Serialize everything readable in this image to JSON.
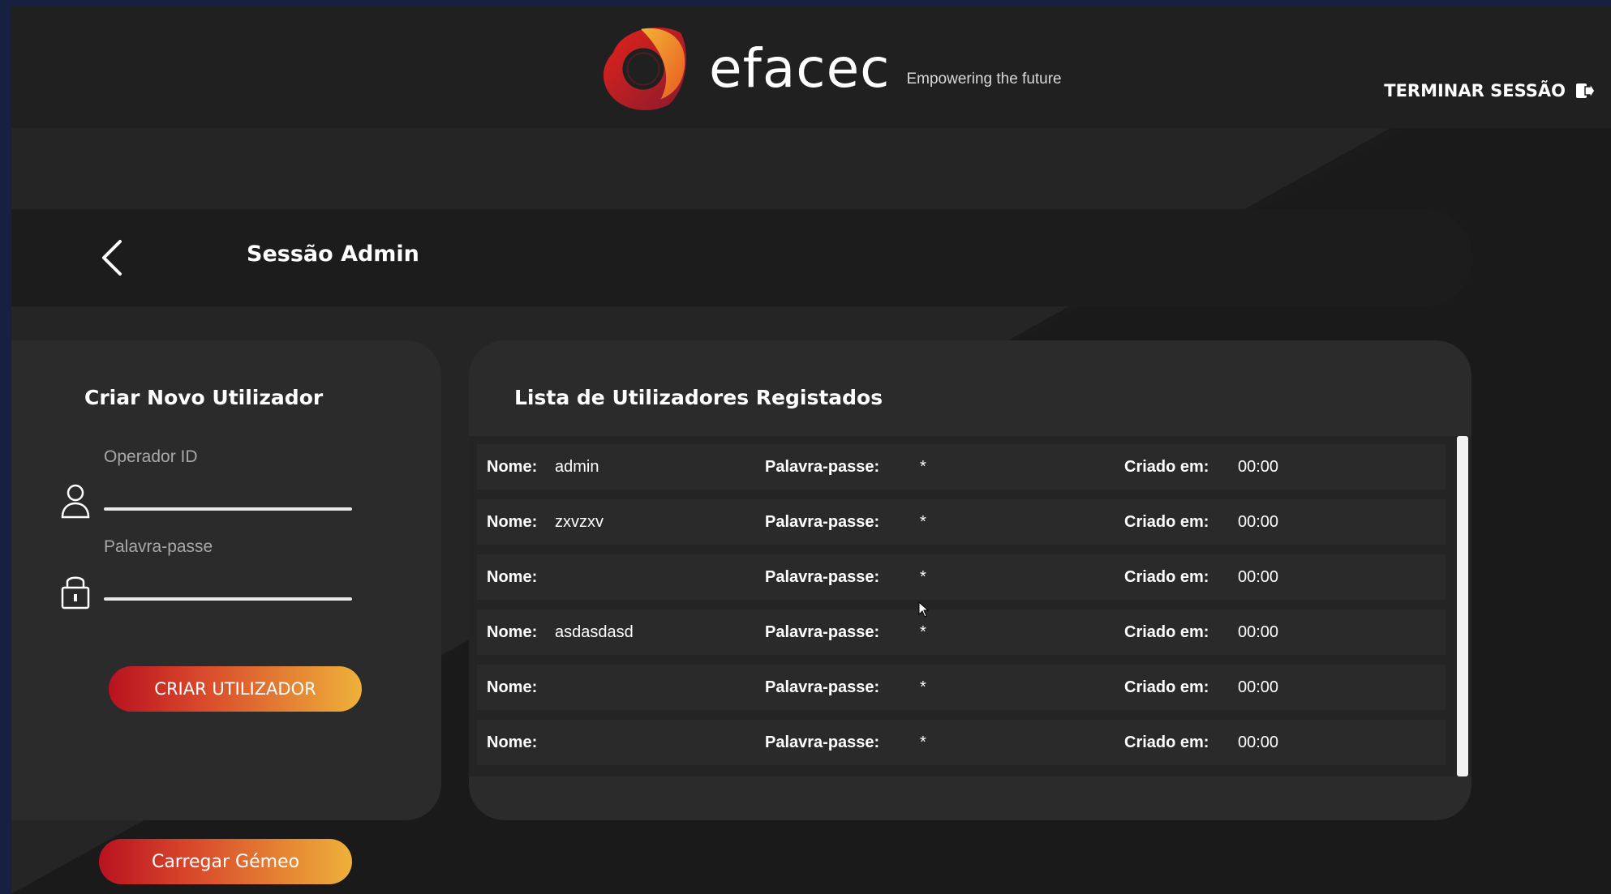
{
  "header": {
    "brand": "efacec",
    "tagline": "Empowering the future",
    "logout_label": "TERMINAR SESSÃO",
    "logout_icon": "logout-icon",
    "logo_colors": [
      "#e2231a",
      "#f3b334",
      "#8b1a2e"
    ]
  },
  "titlebar": {
    "back_icon": "chevron-left-icon",
    "title": "Sessão Admin"
  },
  "create_user": {
    "title": "Criar Novo Utilizador",
    "operator_label": "Operador ID",
    "operator_value": "",
    "operator_icon": "user-icon",
    "password_label": "Palavra-passe",
    "password_value": "",
    "password_icon": "lock-icon",
    "create_button": "CRIAR UTILIZADOR"
  },
  "load_twin_button": "Carregar Gémeo",
  "users_list": {
    "title": "Lista de Utilizadores Registados",
    "name_label": "Nome:",
    "password_label": "Palavra-passe:",
    "created_label": "Criado em:",
    "rows": [
      {
        "name": "admin",
        "password": "*",
        "created": "00:00"
      },
      {
        "name": "zxvzxv",
        "password": "*",
        "created": "00:00"
      },
      {
        "name": "",
        "password": "*",
        "created": "00:00"
      },
      {
        "name": "asdasdasd",
        "password": "*",
        "created": "00:00"
      },
      {
        "name": "",
        "password": "*",
        "created": "00:00"
      },
      {
        "name": "",
        "password": "*",
        "created": "00:00"
      }
    ]
  },
  "colors": {
    "accent_start": "#b8121f",
    "accent_end": "#eeb13a",
    "panel": "#2b2b2c",
    "background": "#1b1b1c"
  }
}
